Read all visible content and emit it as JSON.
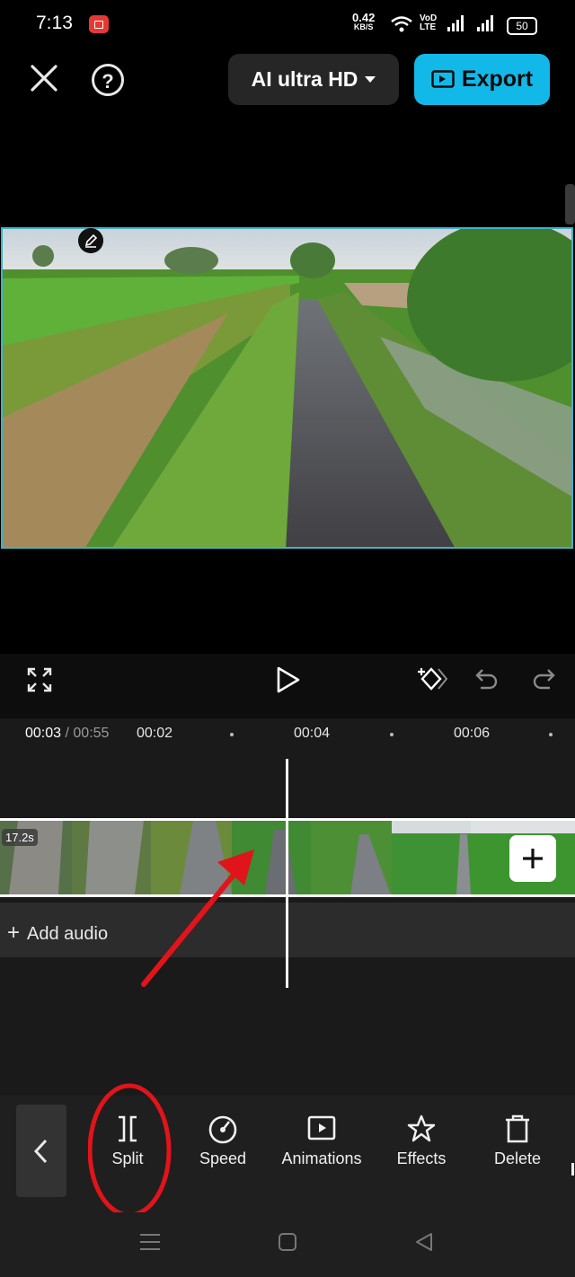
{
  "status_bar": {
    "time": "7:13",
    "net_speed_value": "0.42",
    "net_speed_unit": "KB/S",
    "volte": "VoD LTE",
    "battery": "50"
  },
  "header": {
    "quality_label": "AI ultra HD",
    "export_label": "Export"
  },
  "timeline": {
    "current_time": "00:03",
    "total_time": "/ 00:55",
    "ruler_marks": [
      "00:02",
      "00:04",
      "00:06"
    ],
    "clip_duration": "17.2s",
    "add_audio_label": "Add audio"
  },
  "toolbar": {
    "items": [
      {
        "label": "Split"
      },
      {
        "label": "Speed"
      },
      {
        "label": "Animations"
      },
      {
        "label": "Effects"
      },
      {
        "label": "Delete"
      }
    ]
  },
  "colors": {
    "accent": "#12b9e8",
    "preview_border": "#3fb2c8",
    "annotation": "#e0141a"
  }
}
